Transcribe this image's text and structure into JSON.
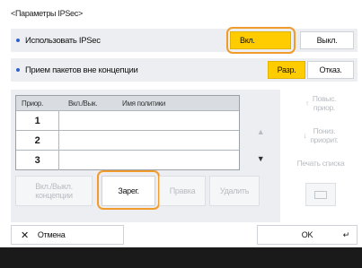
{
  "title": "<Параметры IPSec>",
  "use_ipsec": {
    "label": "Использовать IPSec",
    "on": "Вкл.",
    "off": "Выкл."
  },
  "receive_packets": {
    "label": "Прием пакетов вне концепции",
    "allow": "Разр.",
    "deny": "Отказ."
  },
  "table": {
    "headers": [
      "Приор.",
      "Вкл./Вык.",
      "Имя политики"
    ],
    "rows": [
      "1",
      "2",
      "3"
    ]
  },
  "side_buttons": {
    "raise_priority": "Повыс.\nприор.",
    "lower_priority": "Пониз.\nприорит.",
    "print_list": "Печать списка"
  },
  "bottom_buttons": {
    "toggle": "Вкл./Выкл.\nконцепции",
    "register": "Зарег.",
    "edit": "Правка",
    "delete": "Удалить"
  },
  "footer": {
    "cancel": "Отмена",
    "ok": "OK"
  },
  "colors": {
    "selected": "#ffcc00",
    "highlight": "#f29b2d",
    "accent": "#2b62c9"
  }
}
